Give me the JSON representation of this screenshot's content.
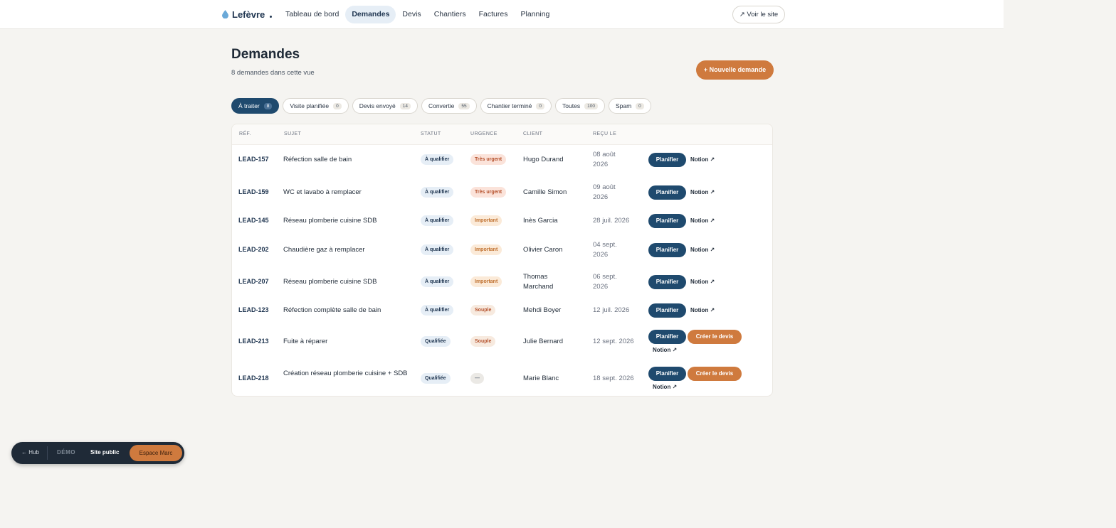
{
  "brand": {
    "name": "Lefèvre",
    "icon": "water-drop-icon"
  },
  "nav": {
    "items": [
      {
        "label": "Tableau de bord",
        "active": false
      },
      {
        "label": "Demandes",
        "active": true
      },
      {
        "label": "Devis",
        "active": false
      },
      {
        "label": "Chantiers",
        "active": false
      },
      {
        "label": "Factures",
        "active": false
      },
      {
        "label": "Planning",
        "active": false
      }
    ],
    "site_link": "↗ Voir le site"
  },
  "header": {
    "title": "Demandes",
    "subtitle": "8 demandes dans cette vue",
    "new_button": "+ Nouvelle demande"
  },
  "filters": [
    {
      "label": "À traiter",
      "count": "8",
      "active": true
    },
    {
      "label": "Visite planifiée",
      "count": "0",
      "active": false
    },
    {
      "label": "Devis envoyé",
      "count": "14",
      "active": false
    },
    {
      "label": "Convertie",
      "count": "55",
      "active": false
    },
    {
      "label": "Chantier terminé",
      "count": "0",
      "active": false
    },
    {
      "label": "Toutes",
      "count": "100",
      "active": false
    },
    {
      "label": "Spam",
      "count": "0",
      "active": false
    }
  ],
  "table": {
    "headers": {
      "ref": "RÉF.",
      "subject": "SUJET",
      "status": "STATUT",
      "urgency": "URGENCE",
      "client": "CLIENT",
      "received": "REÇU LE"
    },
    "rows": [
      {
        "ref": "LEAD-157",
        "subject": "Réfection salle de bain",
        "status": "À qualifier",
        "urgency": "Très urgent",
        "urgency_level": "tres",
        "client": "Hugo Durand",
        "received": "08 août 2026",
        "plan": "Planifier",
        "devis": "",
        "notion": "Notion ↗"
      },
      {
        "ref": "LEAD-159",
        "subject": "WC et lavabo à remplacer",
        "status": "À qualifier",
        "urgency": "Très urgent",
        "urgency_level": "tres",
        "client": "Camille Simon",
        "received": "09 août 2026",
        "plan": "Planifier",
        "devis": "",
        "notion": "Notion ↗"
      },
      {
        "ref": "LEAD-145",
        "subject": "Réseau plomberie cuisine SDB",
        "status": "À qualifier",
        "urgency": "Important",
        "urgency_level": "imp",
        "client": "Inès Garcia",
        "received": "28 juil. 2026",
        "plan": "Planifier",
        "devis": "",
        "notion": "Notion ↗"
      },
      {
        "ref": "LEAD-202",
        "subject": "Chaudière gaz à remplacer",
        "status": "À qualifier",
        "urgency": "Important",
        "urgency_level": "imp",
        "client": "Olivier Caron",
        "received": "04 sept. 2026",
        "plan": "Planifier",
        "devis": "",
        "notion": "Notion ↗"
      },
      {
        "ref": "LEAD-207",
        "subject": "Réseau plomberie cuisine SDB",
        "status": "À qualifier",
        "urgency": "Important",
        "urgency_level": "imp",
        "client": "Thomas Marchand",
        "received": "06 sept. 2026",
        "plan": "Planifier",
        "devis": "",
        "notion": "Notion ↗"
      },
      {
        "ref": "LEAD-123",
        "subject": "Réfection complète salle de bain",
        "status": "À qualifier",
        "urgency": "Souple",
        "urgency_level": "souple",
        "client": "Mehdi Boyer",
        "received": "12 juil. 2026",
        "plan": "Planifier",
        "devis": "",
        "notion": "Notion ↗"
      },
      {
        "ref": "LEAD-213",
        "subject": "Fuite à réparer",
        "status": "Qualifiée",
        "urgency": "Souple",
        "urgency_level": "souple",
        "client": "Julie Bernard",
        "received": "12 sept. 2026",
        "plan": "Planifier",
        "devis": "Créer le devis",
        "notion": "Notion ↗"
      },
      {
        "ref": "LEAD-218",
        "subject": "Création réseau plomberie cuisine + SDB",
        "status": "Qualifiée",
        "urgency": "—",
        "urgency_level": "none",
        "client": "Marie Blanc",
        "received": "18 sept. 2026",
        "plan": "Planifier",
        "devis": "Créer le devis",
        "notion": "Notion ↗"
      }
    ]
  },
  "dock": {
    "hub": "← Hub",
    "demo": "DÉMO",
    "site": "Site public",
    "espace": "Espace Marc"
  },
  "colors": {
    "accent": "#cf7a3e",
    "primary": "#1f4a6e",
    "background": "#f5f4f1"
  }
}
